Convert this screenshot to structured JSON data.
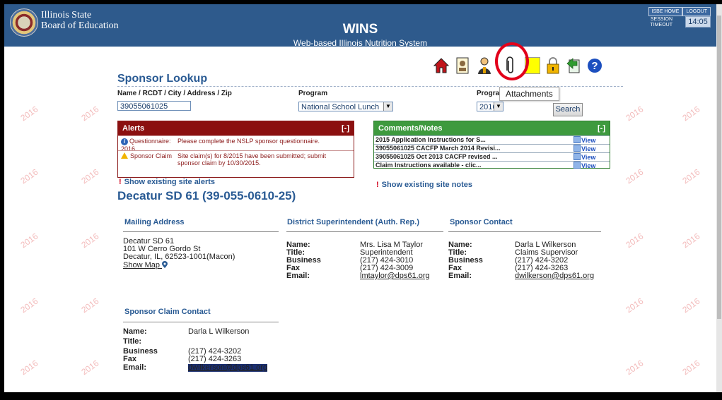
{
  "header": {
    "org_name": "Illinois State\nBoard of Education",
    "app_title": "WINS",
    "app_subtitle": "Web-based Illinois Nutrition System",
    "top_links": [
      "ISBE HOME",
      "LOGOUT"
    ],
    "session_label": "SESSION\nTIMEOUT",
    "session_time": "14:05"
  },
  "watermark": "2016",
  "toolbar": {
    "icons": [
      "home-icon",
      "id-badge-icon",
      "person-icon",
      "attachments-icon",
      "note-icon",
      "lock-icon",
      "export-icon",
      "help-icon"
    ],
    "tooltip": "Attachments",
    "colors": {
      "home": "#c0141a",
      "note": "#ffff00",
      "lock": "#f0b400",
      "export": "#2e9b2e",
      "help": "#1c4fbf"
    }
  },
  "lookup": {
    "title": "Sponsor Lookup",
    "name_label": "Name / RCDT / City / Address / Zip",
    "name_value": "39055061025",
    "program_label": "Program",
    "program_value": "National School Lunch",
    "program_year_label": "Prograi",
    "program_year_value": "2016",
    "search_label": "Search"
  },
  "alerts": {
    "title": "Alerts",
    "collapse": "[-]",
    "rows": [
      {
        "type": "Questionnaire: 2016",
        "message": "Please complete the NSLP sponsor questionnaire.",
        "icon": "info-icon"
      },
      {
        "type": "Sponsor Claim",
        "message": "Site claim(s) for 8/2015 have been submitted; submit sponsor claim by 10/30/2015.",
        "icon": "warning-icon"
      }
    ],
    "show_link": "Show existing site alerts"
  },
  "comments": {
    "title": "Comments/Notes",
    "collapse": "[-]",
    "rows": [
      {
        "text": "2015 Application Instructions for S...",
        "view": "View"
      },
      {
        "text": "39055061025 CACFP March 2014 Revisi...",
        "view": "View"
      },
      {
        "text": "39055061025 Oct 2013 CACFP revised ...",
        "view": "View"
      },
      {
        "text": "Claim Instructions available - clic...",
        "view": "View"
      }
    ],
    "show_link": "Show existing site notes"
  },
  "sponsor": {
    "name": "Decatur SD 61 (39-055-0610-25)",
    "mailing": {
      "title": "Mailing Address",
      "line1": "Decatur SD 61",
      "line2": "101 W Cerro Gordo St",
      "line3": "Decatur, IL, 62523-1001(Macon)",
      "map_link": "Show Map"
    },
    "superintendent": {
      "title": "District Superintendent (Auth. Rep.)",
      "name_label": "Name:",
      "name": "Mrs. Lisa M Taylor",
      "title_label": "Title:",
      "title_value": "Superintendent",
      "business_label": "Business",
      "business": "(217) 424-3010",
      "fax_label": "Fax",
      "fax": "(217) 424-3009",
      "email_label": "Email:",
      "email": "lmtaylor@dps61.org"
    },
    "contact": {
      "title": "Sponsor Contact",
      "name_label": "Name:",
      "name": "Darla L Wilkerson",
      "title_label": "Title:",
      "title_value": "Claims Supervisor",
      "business_label": "Business",
      "business": "(217) 424-3202",
      "fax_label": "Fax",
      "fax": "(217) 424-3263",
      "email_label": "Email:",
      "email": "dwilkerson@dps61.org"
    },
    "claim_contact": {
      "title": "Sponsor Claim Contact",
      "name_label": "Name:",
      "name": "Darla L Wilkerson",
      "title_label": "Title:",
      "title_value": "",
      "business_label": "Business",
      "business": "(217) 424-3202",
      "fax_label": "Fax",
      "fax": "(217) 424-3263",
      "email_label": "Email:",
      "email": "dwilkerson@dps61.org"
    }
  }
}
